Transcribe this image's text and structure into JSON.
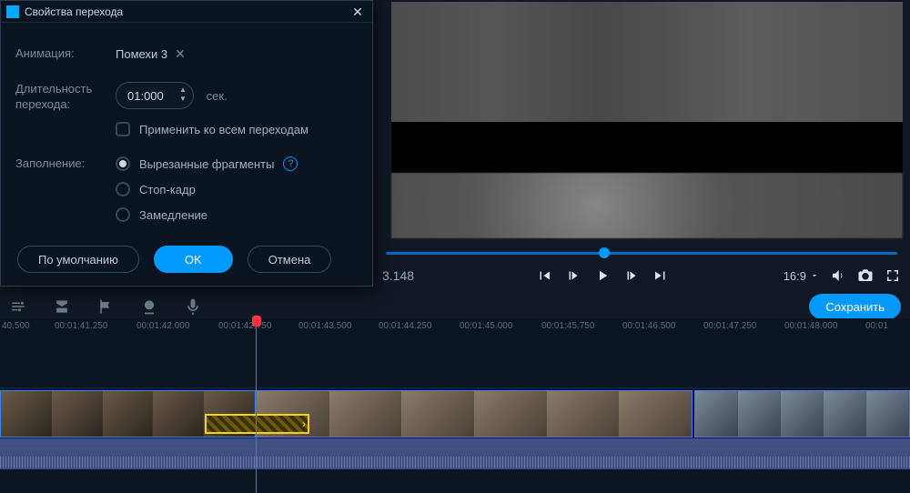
{
  "dialog": {
    "title": "Свойства перехода",
    "rows": {
      "animation_label": "Анимация:",
      "animation_value": "Помехи 3",
      "duration_label": "Длительность перехода:",
      "duration_value": "01:000",
      "duration_unit": "сек.",
      "apply_all": "Применить ко всем переходам",
      "fill_label": "Заполнение:",
      "fill_options": [
        "Вырезанные фрагменты",
        "Стоп-кадр",
        "Замедление"
      ]
    },
    "buttons": {
      "default": "По умолчанию",
      "ok": "OK",
      "cancel": "Отмена"
    }
  },
  "player": {
    "timecode": "3.148",
    "aspect_ratio": "16:9"
  },
  "toolbar": {
    "save": "Сохранить"
  },
  "ruler": {
    "ticks": [
      "40.500",
      "00:01:41.250",
      "00:01:42.000",
      "00:01:42.750",
      "00:01:43.500",
      "00:01:44.250",
      "00:01:45.000",
      "00:01:45.750",
      "00:01:46.500",
      "00:01:47.250",
      "00:01:48.000",
      "00:01"
    ]
  }
}
